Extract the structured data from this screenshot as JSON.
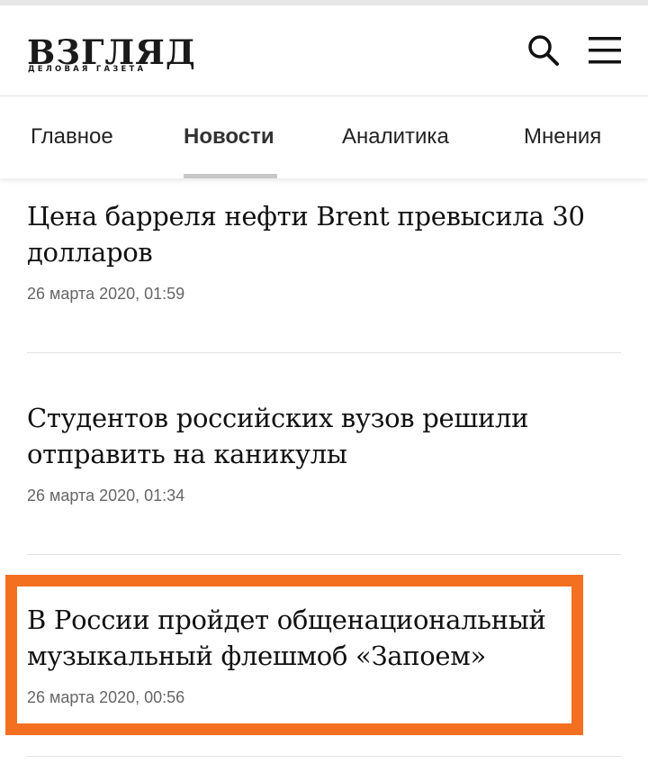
{
  "header": {
    "logo_title": "ВЗГЛЯД",
    "logo_subtitle": "ДЕЛОВАЯ ГАЗЕТА",
    "icons": {
      "search": "search-icon",
      "menu": "hamburger-menu-icon"
    }
  },
  "nav": {
    "tabs": [
      {
        "label": "Главное",
        "active": false
      },
      {
        "label": "Новости",
        "active": true
      },
      {
        "label": "Аналитика",
        "active": false
      },
      {
        "label": "Мнения",
        "active": false
      }
    ]
  },
  "articles": [
    {
      "title": "Цена барреля нефти Brent превысила 30 долларов",
      "date": "26 марта 2020, 01:59",
      "highlighted": false
    },
    {
      "title": "Студентов российских вузов решили отправить на каникулы",
      "date": "26 марта 2020, 01:34",
      "highlighted": false
    },
    {
      "title": "В России пройдет общенациональный музыкальный флешмоб «Запоем»",
      "date": "26 марта 2020, 00:56",
      "highlighted": true
    }
  ],
  "colors": {
    "highlight_border": "#f47021",
    "text": "#111111",
    "date_text": "#666666",
    "active_tab_underline": "#c8c8c8"
  }
}
